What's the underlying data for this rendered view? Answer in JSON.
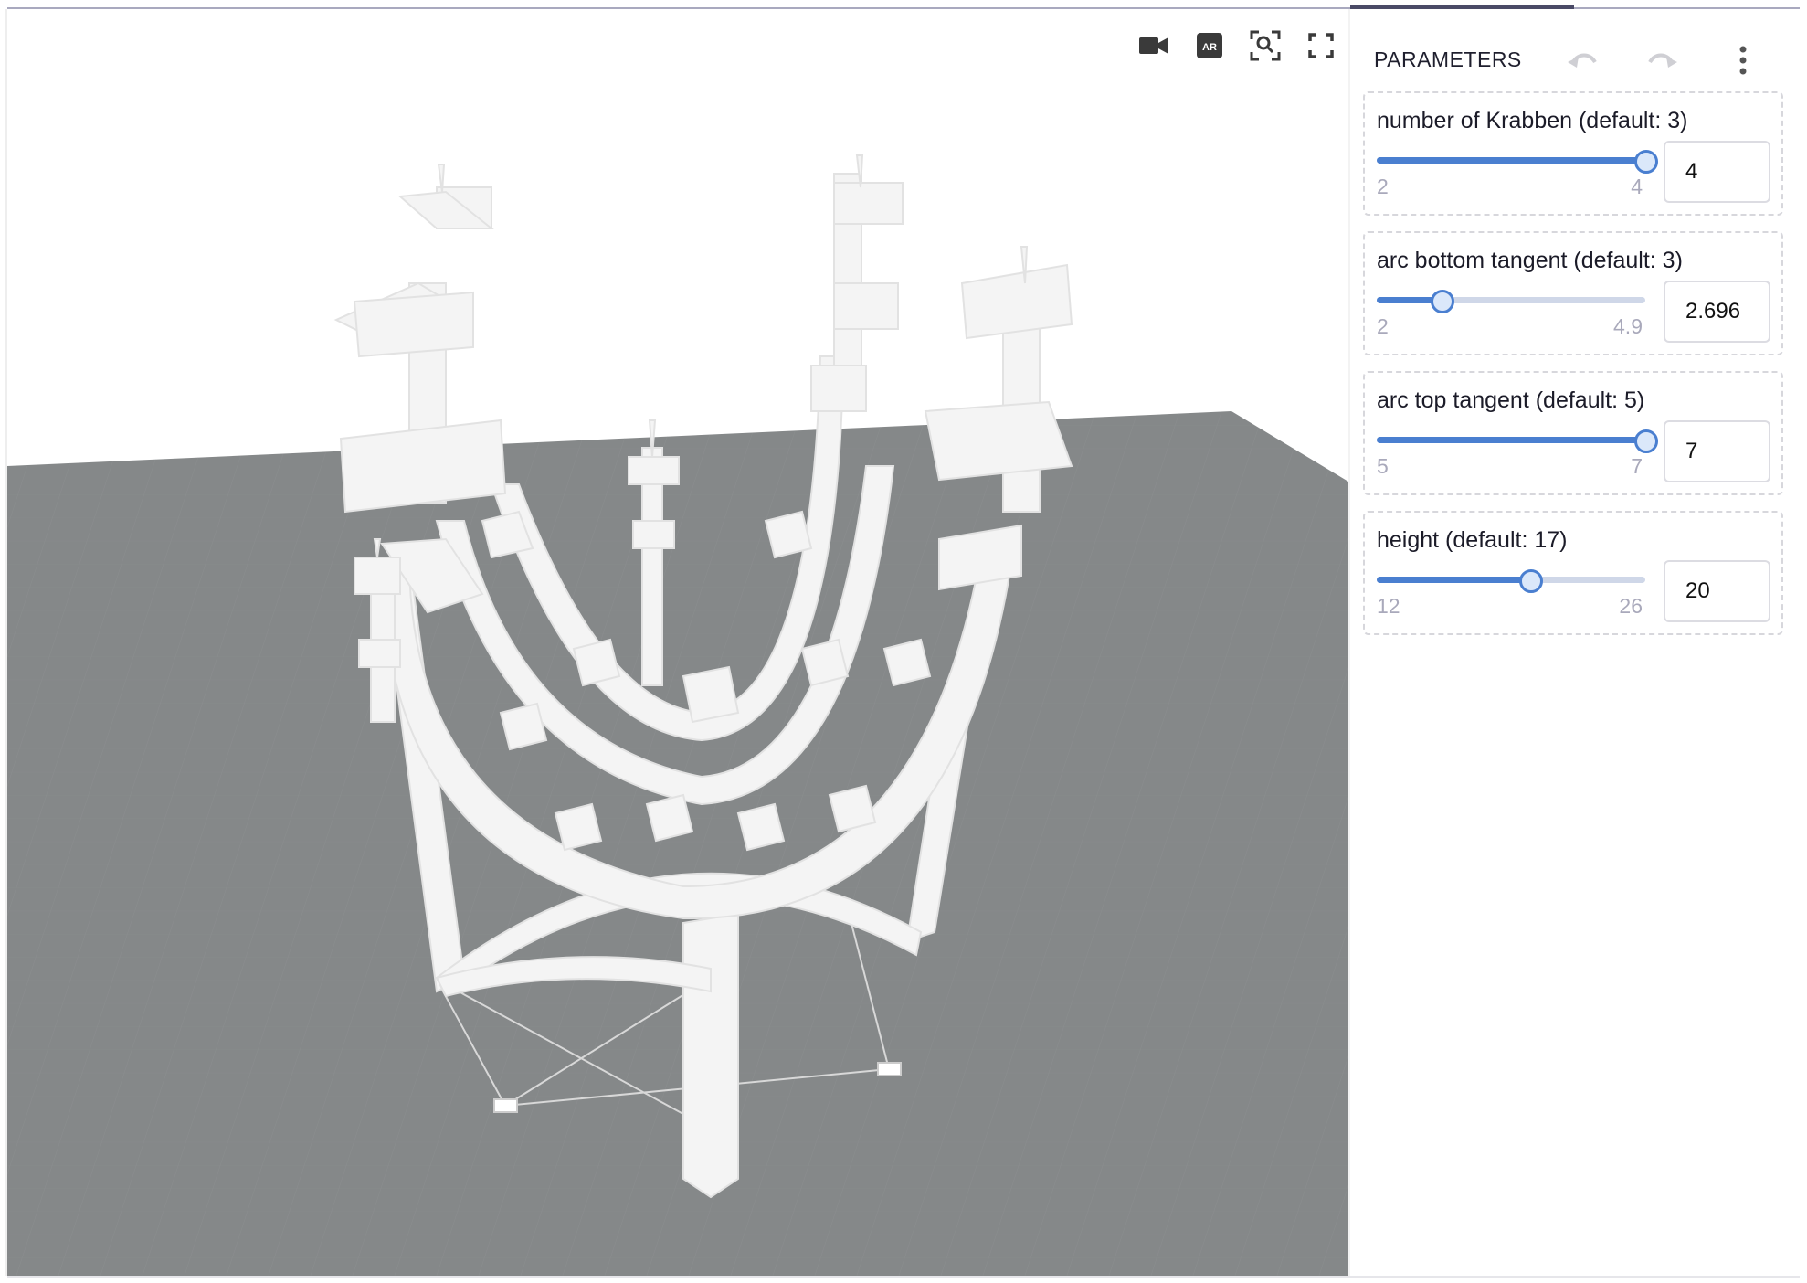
{
  "panel": {
    "title": "PARAMETERS",
    "undo_icon": "undo-icon",
    "redo_icon": "redo-icon",
    "more_icon": "more-vertical-icon"
  },
  "viewport_tools": [
    "video-camera-icon",
    "ar-icon",
    "zoom-to-fit-icon",
    "fullscreen-icon"
  ],
  "params": [
    {
      "label": "number of Krabben (default: 3)",
      "min": "2",
      "max": "4",
      "value": "4",
      "fraction": 1.0
    },
    {
      "label": "arc bottom tangent (default: 3)",
      "min": "2",
      "max": "4.9",
      "value": "2.696",
      "fraction": 0.24
    },
    {
      "label": "arc top tangent (default: 5)",
      "min": "5",
      "max": "7",
      "value": "7",
      "fraction": 1.0
    },
    {
      "label": "height (default: 17)",
      "min": "12",
      "max": "26",
      "value": "20",
      "fraction": 0.571
    }
  ],
  "colors": {
    "accent": "#4a7fd0",
    "ground": "#858889",
    "model": "#f4f4f4",
    "tab_indicator": "#4a4a66"
  }
}
